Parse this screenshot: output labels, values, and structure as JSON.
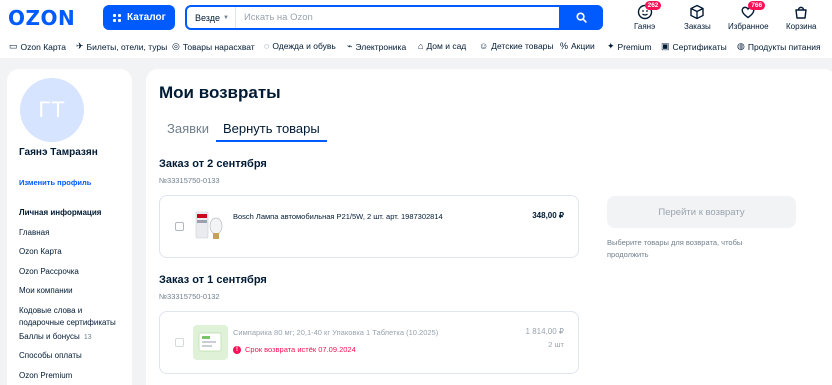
{
  "header": {
    "logo": "OZON",
    "catalog_label": "Каталог",
    "search_scope": "Везде",
    "search_placeholder": "Искать на Ozon",
    "actions": [
      {
        "label": "Гаянэ",
        "badge": "262",
        "icon": "user-icon"
      },
      {
        "label": "Заказы",
        "badge": "",
        "icon": "box-icon"
      },
      {
        "label": "Избранное",
        "badge": "766",
        "icon": "heart-icon"
      },
      {
        "label": "Корзина",
        "badge": "",
        "icon": "cart-icon"
      }
    ]
  },
  "categories": [
    {
      "label": "Ozon Карта",
      "icon": "card-icon"
    },
    {
      "label": "Билеты, отели, туры",
      "icon": "plane-icon"
    },
    {
      "label": "Товары нарасхват",
      "icon": "fire-icon"
    },
    {
      "label": "Одежда и обувь",
      "icon": "shirt-icon"
    },
    {
      "label": "Электроника",
      "icon": "plug-icon"
    },
    {
      "label": "Дом и сад",
      "icon": "home-icon"
    },
    {
      "label": "Детские товары",
      "icon": "kids-icon"
    },
    {
      "label": "Акции",
      "icon": "percent-icon"
    },
    {
      "label": "Premium",
      "icon": "star-icon"
    },
    {
      "label": "Сертификаты",
      "icon": "gift-icon"
    },
    {
      "label": "Продукты питания",
      "icon": "food-icon"
    }
  ],
  "sidebar": {
    "avatar_initials": "ГТ",
    "user_name": "Гаянэ Тамразян",
    "edit_profile": "Изменить профиль",
    "section_title": "Личная информация",
    "items": [
      {
        "label": "Главная"
      },
      {
        "label": "Ozon Карта"
      },
      {
        "label": "Ozon Рассрочка"
      },
      {
        "label": "Мои компании"
      },
      {
        "label": "Кодовые слова и подарочные сертификаты"
      },
      {
        "label": "Баллы и бонусы",
        "count": "13"
      },
      {
        "label": "Способы оплаты"
      },
      {
        "label": "Ozon Premium"
      }
    ]
  },
  "main": {
    "title": "Мои возвраты",
    "tabs": [
      {
        "label": "Заявки",
        "active": false
      },
      {
        "label": "Вернуть товары",
        "active": true
      }
    ],
    "orders": [
      {
        "title": "Заказ от 2 сентября",
        "number": "№33315750-0133",
        "product_name": "Bosch Лампа автомобильная P21/5W, 2 шт. арт. 1987302814",
        "price": "348,00 ₽",
        "qty": "",
        "expired_text": ""
      },
      {
        "title": "Заказ от 1 сентября",
        "number": "№33315750-0132",
        "product_name": "Симпарика 80 мг; 20,1-40 кг Упаковка 1 Таблетка (10.2025)",
        "price": "1 814,00 ₽",
        "qty": "2 шт",
        "expired_text": "Срок возврата истёк 07.09.2024"
      }
    ],
    "return_button": "Перейти к возврату",
    "hint": "Выберите товары для возврата, чтобы продолжить"
  },
  "colors": {
    "brand": "#005bff",
    "accent_red": "#f91155",
    "text": "#001a34",
    "muted": "#707f8d"
  }
}
